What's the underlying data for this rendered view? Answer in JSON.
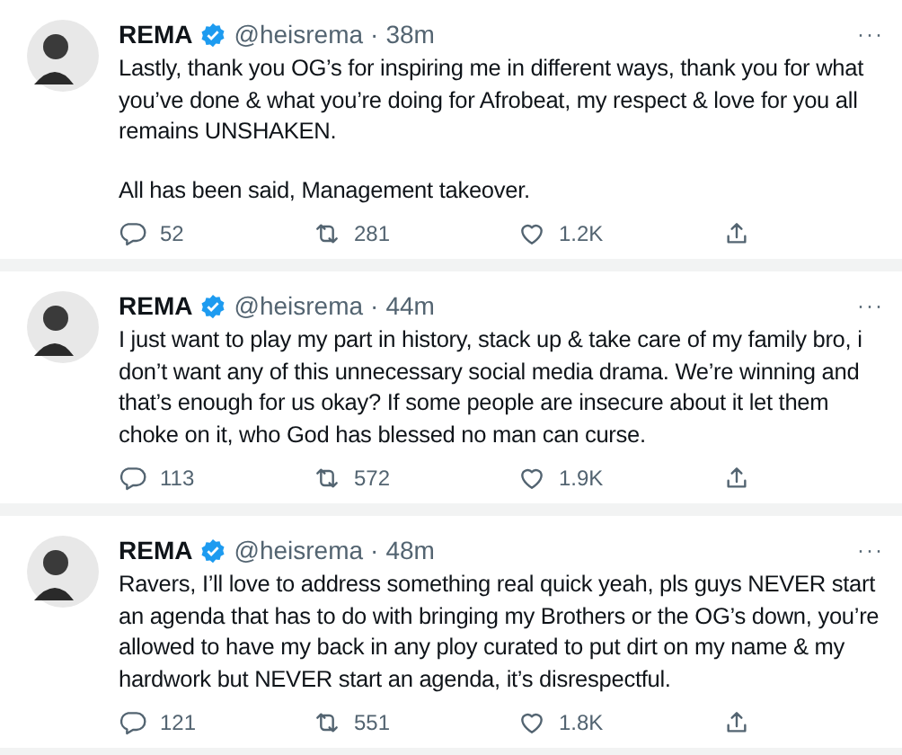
{
  "tweets": [
    {
      "name": "REMA",
      "handle": "@heisrema",
      "separator": "·",
      "time": "38m",
      "more": "···",
      "paragraphs": [
        "Lastly, thank you OG’s for inspiring me in different ways, thank you for what you’ve done & what you’re doing for Afrobeat, my respect & love for you all remains UNSHAKEN.",
        "All has been said, Management takeover."
      ],
      "replies": "52",
      "retweets": "281",
      "likes": "1.2K"
    },
    {
      "name": "REMA",
      "handle": "@heisrema",
      "separator": "·",
      "time": "44m",
      "more": "···",
      "paragraphs": [
        "I just want to play my part in history, stack up & take care of my family bro, i don’t want any of this unnecessary social media drama. We’re winning and that’s enough for us okay? If some people are insecure about it let them choke on it, who God has blessed no man can curse."
      ],
      "replies": "113",
      "retweets": "572",
      "likes": "1.9K"
    },
    {
      "name": "REMA",
      "handle": "@heisrema",
      "separator": "·",
      "time": "48m",
      "more": "···",
      "paragraphs": [
        "Ravers, I’ll love to address something real quick yeah, pls guys NEVER start an agenda that has to do with bringing my Brothers or the OG’s down, you’re allowed to have my back in any ploy curated to put dirt on my name & my hardwork but NEVER start an agenda, it’s disrespectful."
      ],
      "replies": "121",
      "retweets": "551",
      "likes": "1.8K"
    }
  ]
}
